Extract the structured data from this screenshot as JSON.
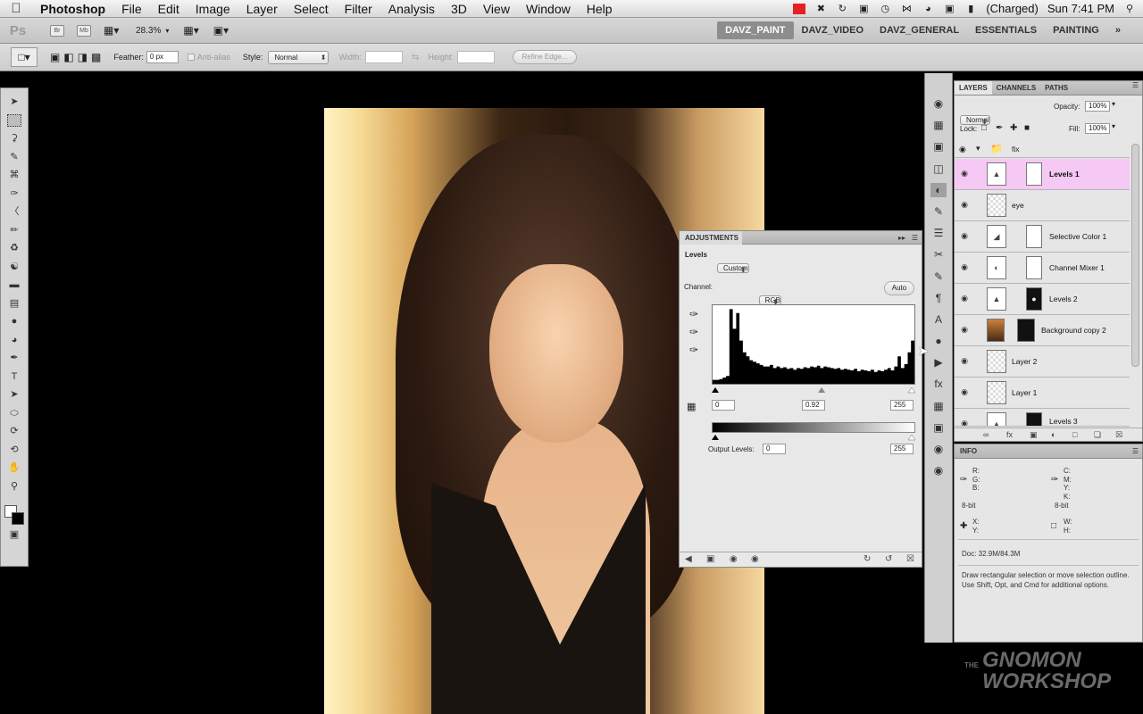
{
  "menubar": {
    "app_name": "Photoshop",
    "items": [
      "File",
      "Edit",
      "Image",
      "Layer",
      "Select",
      "Filter",
      "Analysis",
      "3D",
      "View",
      "Window",
      "Help"
    ],
    "battery_status": "(Charged)",
    "clock": "Sun 7:41 PM"
  },
  "appbar": {
    "logo": "Ps",
    "br": "Br",
    "mb": "Mb",
    "zoom": "28.3%",
    "workspaces": [
      "DAVZ_PAINT",
      "DAVZ_VIDEO",
      "DAVZ_GENERAL",
      "ESSENTIALS",
      "PAINTING"
    ],
    "more": "»"
  },
  "options": {
    "feather_label": "Feather:",
    "feather_value": "0 px",
    "antialias_label": "Anti-alias",
    "style_label": "Style:",
    "style_value": "Normal",
    "width_label": "Width:",
    "height_label": "Height:",
    "refine_edge": "Refine Edge..."
  },
  "adjustments": {
    "title": "ADJUSTMENTS",
    "levels_label": "Levels",
    "preset_value": "Custom",
    "channel_label": "Channel:",
    "channel_value": "RGB",
    "auto_label": "Auto",
    "input_black": "0",
    "input_gamma": "0.92",
    "input_white": "255",
    "output_label": "Output Levels:",
    "output_black": "0",
    "output_white": "255"
  },
  "layers": {
    "tabs": [
      "LAYERS",
      "CHANNELS",
      "PATHS"
    ],
    "blend_mode": "Normal",
    "opacity_label": "Opacity:",
    "opacity_value": "100%",
    "lock_label": "Lock:",
    "fill_label": "Fill:",
    "fill_value": "100%",
    "group_name": "fix",
    "rows": [
      {
        "name": "Levels 1"
      },
      {
        "name": "eye"
      },
      {
        "name": "Selective Color 1"
      },
      {
        "name": "Channel Mixer 1"
      },
      {
        "name": "Levels 2"
      },
      {
        "name": "Background copy 2"
      },
      {
        "name": "Layer 2"
      },
      {
        "name": "Layer 1"
      },
      {
        "name": "Levels 3"
      }
    ]
  },
  "info": {
    "title": "INFO",
    "rgb_labels": "R:\nG:\nB:",
    "cmyk_labels": "C:\nM:\nY:\nK:",
    "bitdepth_left": "8-bit",
    "bitdepth_right": "8-bit",
    "xy_labels": "X:\nY:",
    "wh_labels": "W:\nH:",
    "doc": "Doc: 32.9M/84.3M",
    "hint": "Draw rectangular selection or move selection outline.  Use Shift, Opt, and Cmd for additional options."
  },
  "watermark": {
    "line0": "THE",
    "line1": "GNOMON",
    "line2": "WORKSHOP"
  },
  "histogram": {
    "levels": [
      0.05,
      0.05,
      0.06,
      0.08,
      0.1,
      0.95,
      0.7,
      0.9,
      0.55,
      0.4,
      0.35,
      0.3,
      0.28,
      0.26,
      0.24,
      0.22,
      0.22,
      0.24,
      0.2,
      0.22,
      0.2,
      0.21,
      0.19,
      0.2,
      0.18,
      0.2,
      0.19,
      0.21,
      0.2,
      0.22,
      0.21,
      0.23,
      0.2,
      0.22,
      0.21,
      0.2,
      0.19,
      0.2,
      0.18,
      0.19,
      0.18,
      0.17,
      0.19,
      0.16,
      0.18,
      0.17,
      0.16,
      0.18,
      0.15,
      0.17,
      0.16,
      0.18,
      0.2,
      0.17,
      0.22,
      0.35,
      0.2,
      0.25,
      0.4,
      0.55
    ],
    "gamma_position": 0.54
  }
}
